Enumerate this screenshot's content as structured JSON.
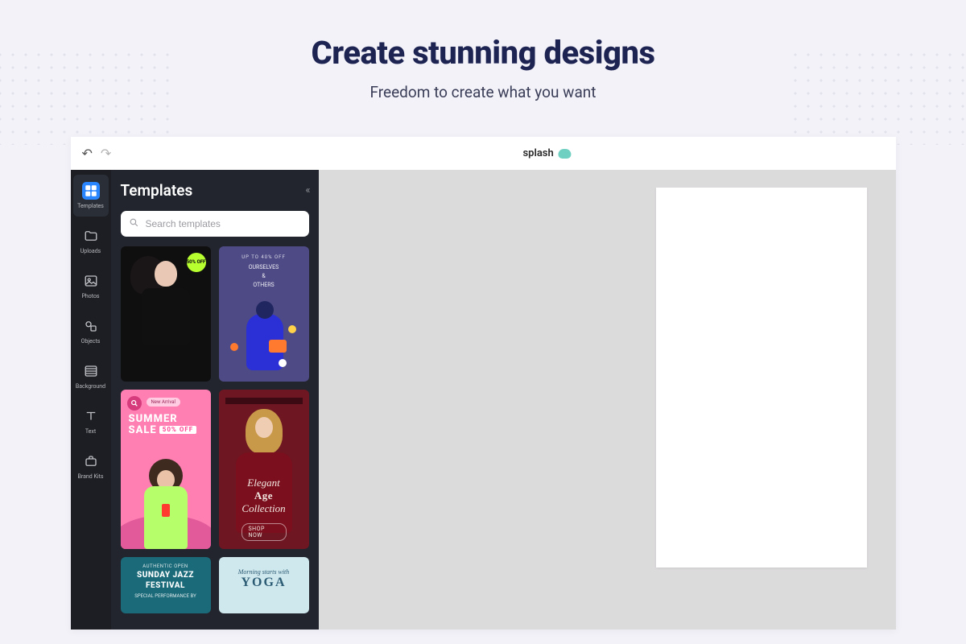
{
  "hero": {
    "title": "Create stunning designs",
    "subtitle": "Freedom to create what you want"
  },
  "topbar": {
    "brand": "splash"
  },
  "iconbar": {
    "items": [
      {
        "label": "Templates"
      },
      {
        "label": "Uploads"
      },
      {
        "label": "Photos"
      },
      {
        "label": "Objects"
      },
      {
        "label": "Background"
      },
      {
        "label": "Text"
      },
      {
        "label": "Brand Kits"
      }
    ]
  },
  "panel": {
    "title": "Templates",
    "search_placeholder": "Search templates"
  },
  "templates": {
    "t1": {
      "badge": "50% OFF"
    },
    "t2": {
      "top": "UP TO 40% OFF",
      "line1": "OURSELVES",
      "line2": "&",
      "line3": "OTHERS"
    },
    "t3": {
      "pill": "New Arrival",
      "title_a": "SUMMER",
      "title_b": "SALE",
      "sale": "50% OFF"
    },
    "t4": {
      "l1": "Elegant",
      "l2": "Age",
      "l3": "Collection",
      "shop": "SHOP NOW"
    },
    "t5": {
      "sm": "AUTHENTIC OPEN",
      "big1": "SUNDAY JAZZ",
      "big2": "FESTIVAL",
      "sub": "SPECIAL PERFORMANCE BY"
    },
    "t6": {
      "a": "Morning starts with",
      "b": "YOGA"
    }
  }
}
